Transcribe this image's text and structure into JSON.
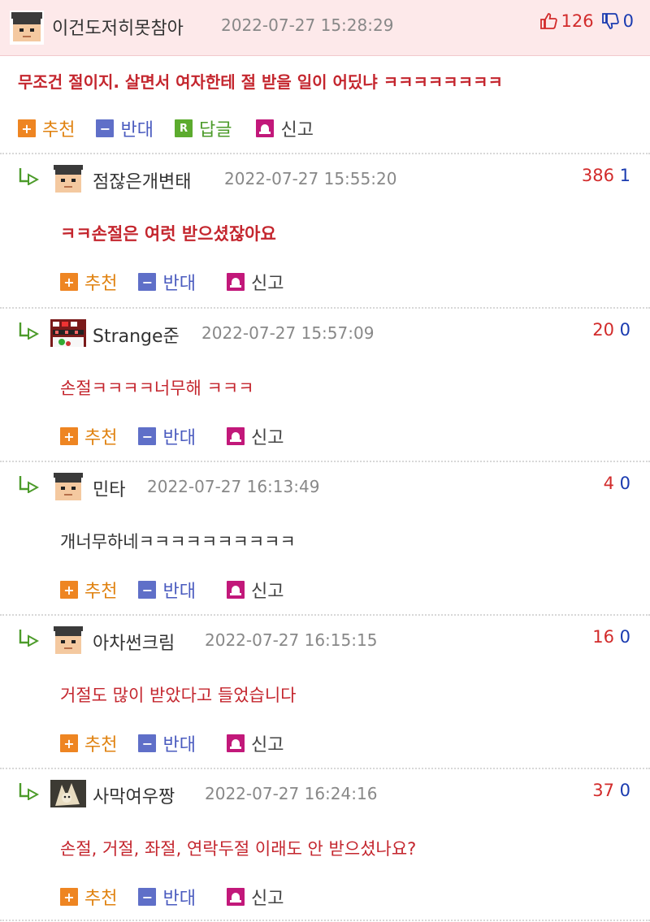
{
  "post": {
    "nickname": "이건도저히못참아",
    "datetime": "2022-07-27 15:28:29",
    "upvotes": "126",
    "downvotes": "0",
    "text": "무조건 절이지. 살면서 여자한테 절 받을 일이 어딨냐 ㅋㅋㅋㅋㅋㅋㅋㅋ",
    "actions": {
      "recommend": "추천",
      "oppose": "반대",
      "reply": "답글",
      "report": "신고",
      "reply_icon_letter": "R"
    }
  },
  "comments": [
    {
      "nickname": "점잖은개변태",
      "datetime": "2022-07-27 15:55:20",
      "up": "386",
      "down": "1",
      "text": "ㅋㅋ손절은 여럿 받으셨잖아요",
      "bold": true,
      "text_color": "#c4262e",
      "avatar": "default"
    },
    {
      "nickname": "Strange준",
      "datetime": "2022-07-27 15:57:09",
      "up": "20",
      "down": "0",
      "text": "손절ㅋㅋㅋㅋ너무해 ㅋㅋㅋ",
      "bold": false,
      "text_color": "#c4262e",
      "avatar": "strange"
    },
    {
      "nickname": "민타",
      "datetime": "2022-07-27 16:13:49",
      "up": "4",
      "down": "0",
      "text": "개너무하네ㅋㅋㅋㅋㅋㅋㅋㅋㅋㅋ",
      "bold": false,
      "text_color": "#333333",
      "avatar": "default"
    },
    {
      "nickname": "아차썬크림",
      "datetime": "2022-07-27 16:15:15",
      "up": "16",
      "down": "0",
      "text": "거절도 많이 받았다고 들었습니다",
      "bold": false,
      "text_color": "#c4262e",
      "avatar": "default"
    },
    {
      "nickname": "사막여우짱",
      "datetime": "2022-07-27 16:24:16",
      "up": "37",
      "down": "0",
      "text": "손절, 거절, 좌절, 연락두절 이래도 안 받으셨나요?",
      "bold": false,
      "text_color": "#c4262e",
      "avatar": "fox"
    }
  ],
  "colors": {
    "upvote": "#d22b2b",
    "downvote": "#1a3bb0",
    "recommend": "#e08210",
    "oppose": "#4a5bbf",
    "reply": "#4c9b2a",
    "report_icon": "#c2187a",
    "header_bg": "#fde9ea"
  },
  "icons": [
    "thumbs-up-icon",
    "thumbs-down-icon",
    "reply-arrow-icon",
    "plus-icon",
    "minus-icon",
    "reply-icon",
    "alarm-icon"
  ]
}
